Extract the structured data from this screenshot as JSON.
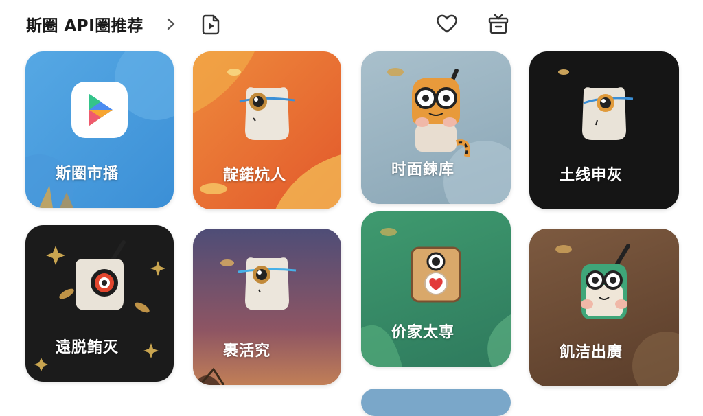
{
  "header": {
    "title": "斯圈 API圈推荐",
    "icons": [
      "chevron-right-icon",
      "play-file-icon",
      "heart-icon",
      "gift-box-icon"
    ]
  },
  "cards": [
    {
      "label": "斯圈市播",
      "color": "#4ea0e0"
    },
    {
      "label": "靛鍩炕人",
      "color": "#e97a35"
    },
    {
      "label": "时面鍊库",
      "color": "#9db6c4"
    },
    {
      "label": "土线申灰",
      "color": "#151515"
    },
    {
      "label": "遠脱鲔灭",
      "color": "#1b1b1b"
    },
    {
      "label": "裹活究",
      "color": "#6c5770"
    },
    {
      "label": "价家太専",
      "color": "#3a8e68"
    },
    {
      "label": "飢洁出廣",
      "color": "#6c4b34"
    }
  ]
}
